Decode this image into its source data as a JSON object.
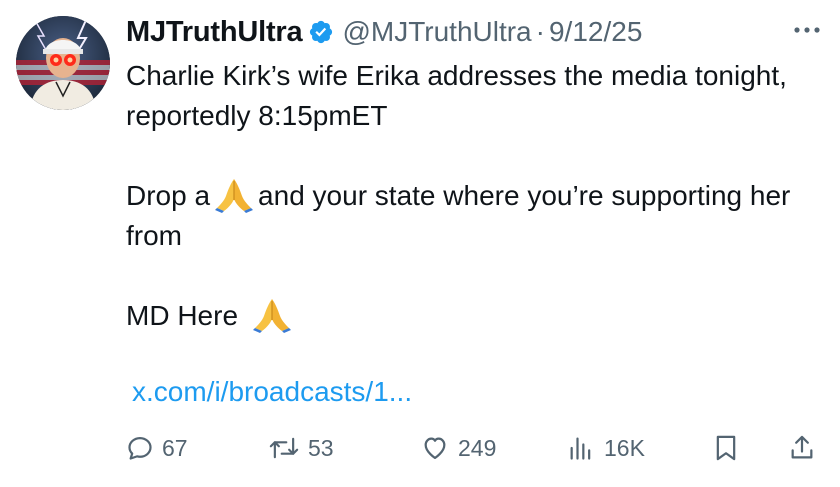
{
  "user": {
    "display_name": "MJTruthUltra",
    "handle": "@MJTruthUltra",
    "separator": "·",
    "date": "9/12/25",
    "verified_icon": "verified-badge-icon",
    "avatar": "avatar"
  },
  "tweet": {
    "line1": "Charlie Kirk’s wife Erika addresses the media tonight, reportedly 8:15pmET",
    "line2_before": "Drop a",
    "line2_after": "and your state where you’re supporting her from",
    "line3": "MD Here",
    "emoji": "folded-hands-emoji",
    "link": "x.com/i/broadcasts/1..."
  },
  "actions": {
    "replies": "67",
    "reposts": "53",
    "likes": "249",
    "views": "16K"
  },
  "colors": {
    "text": "#0f1419",
    "secondary": "#536471",
    "link": "#1d9bf0",
    "verified": "#1d9bf0"
  }
}
